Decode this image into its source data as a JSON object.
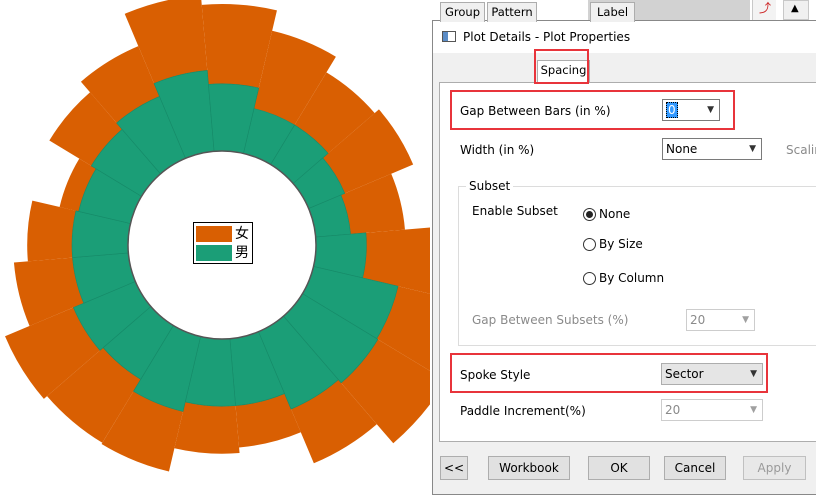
{
  "chart": {
    "legend": [
      {
        "label": "女",
        "color": "#d95f02"
      },
      {
        "label": "男",
        "color": "#1b9e77"
      }
    ],
    "colors": {
      "outer": "#d95f02",
      "inner": "#1b9e77",
      "hole_stroke": "#555555"
    }
  },
  "chart_data": {
    "type": "bar",
    "series": [
      {
        "name": "女",
        "values": [
          57,
          44,
          53,
          39,
          54,
          69,
          57,
          42,
          30,
          34,
          44,
          53,
          53,
          42,
          32,
          14,
          35,
          39,
          54,
          57
        ]
      },
      {
        "name": "男",
        "values": [
          33,
          33,
          28,
          25,
          36,
          62,
          63,
          60,
          48,
          48,
          55,
          45,
          48,
          40,
          40,
          38,
          42,
          48,
          58,
          48
        ]
      }
    ]
  },
  "background": {
    "toolbar_glyph": "⤴",
    "scroll_up": "▲"
  },
  "dialog": {
    "title": "Plot Details - Plot Properties",
    "tabs": [
      "Group",
      "Pattern",
      "Spacing",
      "Label"
    ],
    "active_tab": "Spacing",
    "gap_between_bars": {
      "label": "Gap Between Bars (in %)",
      "value": "0"
    },
    "width": {
      "label": "Width (in %)",
      "value": "None",
      "extra": "Scalin"
    },
    "subset": {
      "title": "Subset",
      "enable_label": "Enable Subset",
      "options": [
        "None",
        "By Size",
        "By Column"
      ],
      "selected": "None",
      "gap_between_subsets": {
        "label": "Gap Between Subsets (%)",
        "value": "20"
      }
    },
    "spoke_style": {
      "label": "Spoke Style",
      "value": "Sector"
    },
    "paddle_increment": {
      "label": "Paddle Increment(%)",
      "value": "20"
    },
    "buttons": {
      "back": "<<",
      "workbook": "Workbook",
      "ok": "OK",
      "cancel": "Cancel",
      "apply": "Apply"
    }
  }
}
